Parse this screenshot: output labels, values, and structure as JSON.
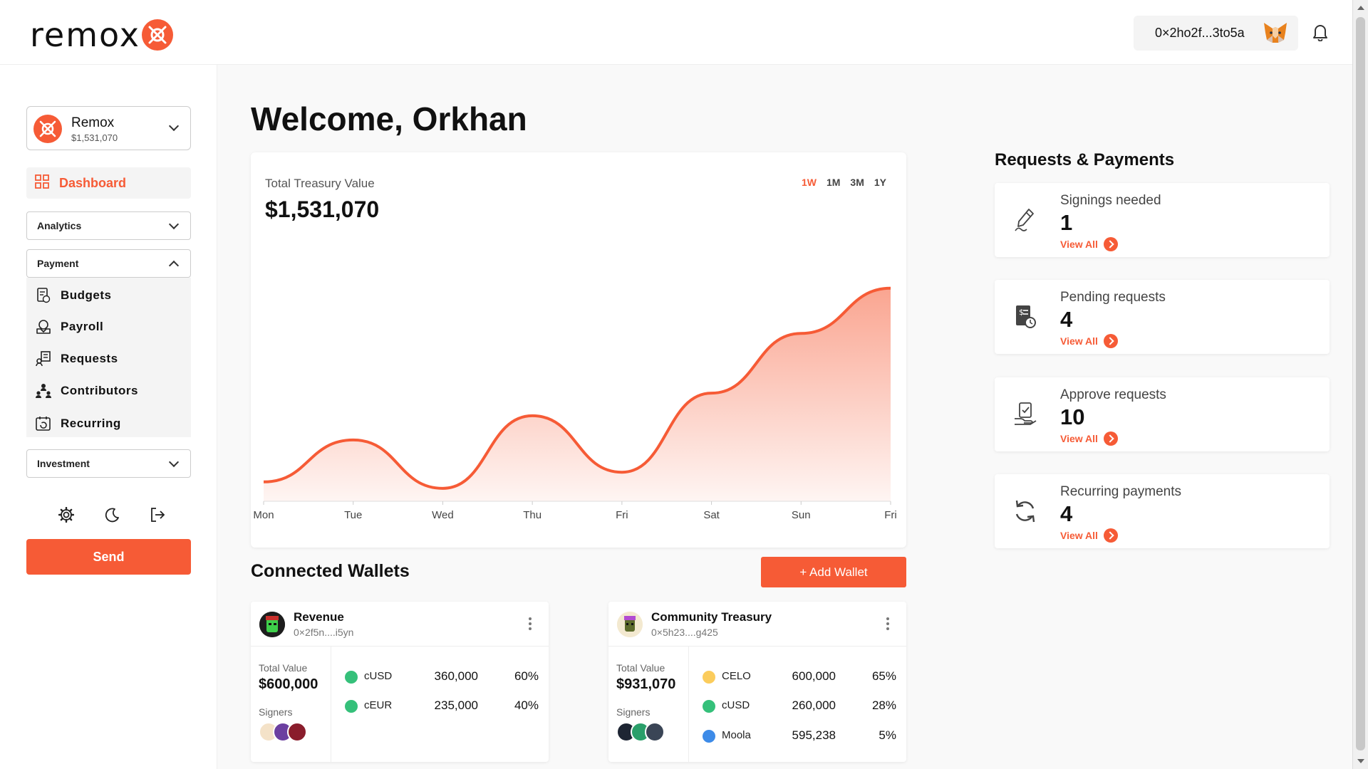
{
  "brand": {
    "name": "remox"
  },
  "header": {
    "wallet_address": "0×2ho2f...3to5a"
  },
  "sidebar": {
    "account": {
      "name": "Remox",
      "value": "$1,531,070"
    },
    "dashboard": "Dashboard",
    "analytics": "Analytics",
    "payment": "Payment",
    "payment_items": [
      "Budgets",
      "Payroll",
      "Requests",
      "Contributors",
      "Recurring"
    ],
    "investment": "Investment",
    "send": "Send"
  },
  "main": {
    "welcome": "Welcome, Orkhan",
    "treasury": {
      "label": "Total Treasury Value",
      "value": "$1,531,070",
      "ranges": [
        "1W",
        "1M",
        "3M",
        "1Y"
      ],
      "active_range": "1W"
    },
    "connected_wallets_title": "Connected Wallets",
    "add_wallet": "+ Add Wallet",
    "wallets": [
      {
        "name": "Revenue",
        "address": "0×2f5n....i5yn",
        "total_label": "Total Value",
        "total": "$600,000",
        "signers_label": "Signers",
        "tokens": [
          {
            "name": "cUSD",
            "amount": "360,000",
            "pct": "60%",
            "color": "#35c07a"
          },
          {
            "name": "cEUR",
            "amount": "235,000",
            "pct": "40%",
            "color": "#35c07a"
          }
        ]
      },
      {
        "name": "Community Treasury",
        "address": "0×5h23....g425",
        "total_label": "Total Value",
        "total": "$931,070",
        "signers_label": "Signers",
        "tokens": [
          {
            "name": "CELO",
            "amount": "600,000",
            "pct": "65%",
            "color": "#fbcc5c"
          },
          {
            "name": "cUSD",
            "amount": "260,000",
            "pct": "28%",
            "color": "#35c07a"
          },
          {
            "name": "Moola",
            "amount": "595,238",
            "pct": "5%",
            "color": "#3d8be8"
          }
        ]
      }
    ]
  },
  "requests": {
    "title": "Requests & Payments",
    "view_all": "View All",
    "cards": [
      {
        "label": "Signings needed",
        "count": "1",
        "icon": "pen-icon"
      },
      {
        "label": "Pending requests",
        "count": "4",
        "icon": "receipt-clock-icon"
      },
      {
        "label": "Approve requests",
        "count": "10",
        "icon": "hand-check-icon"
      },
      {
        "label": "Recurring payments",
        "count": "4",
        "icon": "refresh-icon"
      }
    ]
  },
  "chart_data": {
    "type": "area",
    "title": "",
    "categories": [
      "Mon",
      "Tue",
      "Wed",
      "Thu",
      "Fri",
      "Sat",
      "Sun",
      "Fri"
    ],
    "series": [
      {
        "values": [
          12,
          38,
          8,
          53,
          18,
          67,
          104,
          132
        ]
      }
    ],
    "xlabel": "",
    "ylabel": "",
    "ylim": [
      0,
      150
    ],
    "grid": false,
    "color": "#f65b36"
  },
  "colors": {
    "accent": "#f65b36"
  }
}
